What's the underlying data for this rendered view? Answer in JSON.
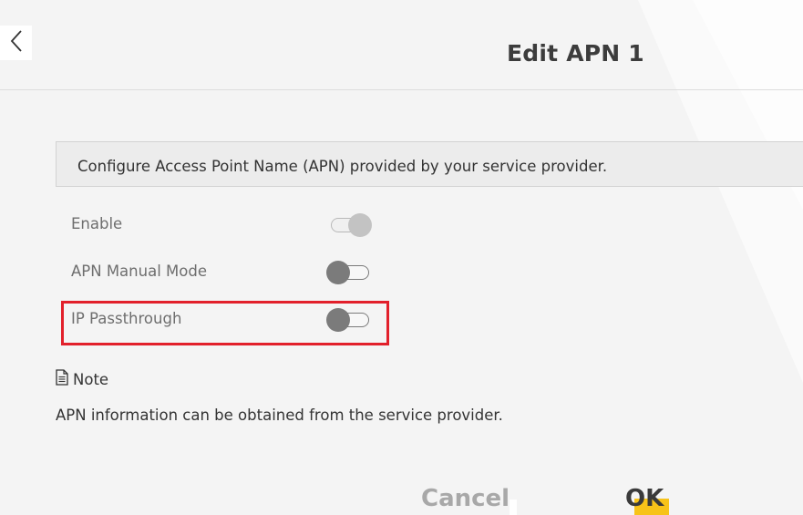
{
  "header": {
    "back_icon": "chevron-left-icon",
    "title": "Edit APN 1"
  },
  "info_box": {
    "text": "Configure Access Point Name (APN) provided by your service provider."
  },
  "settings": [
    {
      "label": "Enable",
      "state": "on",
      "disabled": true
    },
    {
      "label": "APN Manual Mode",
      "state": "off"
    },
    {
      "label": "IP Passthrough",
      "state": "off",
      "highlighted": true
    }
  ],
  "note": {
    "icon": "document-icon",
    "title": "Note",
    "text": "APN information can be obtained from the service provider."
  },
  "actions": {
    "cancel_label": "Cancel",
    "ok_label": "OK"
  },
  "colors": {
    "background": "#f4f4f4",
    "highlight_border": "#e2202b",
    "ok_accent": "#f7c319",
    "title_text": "#3c3c3c"
  }
}
